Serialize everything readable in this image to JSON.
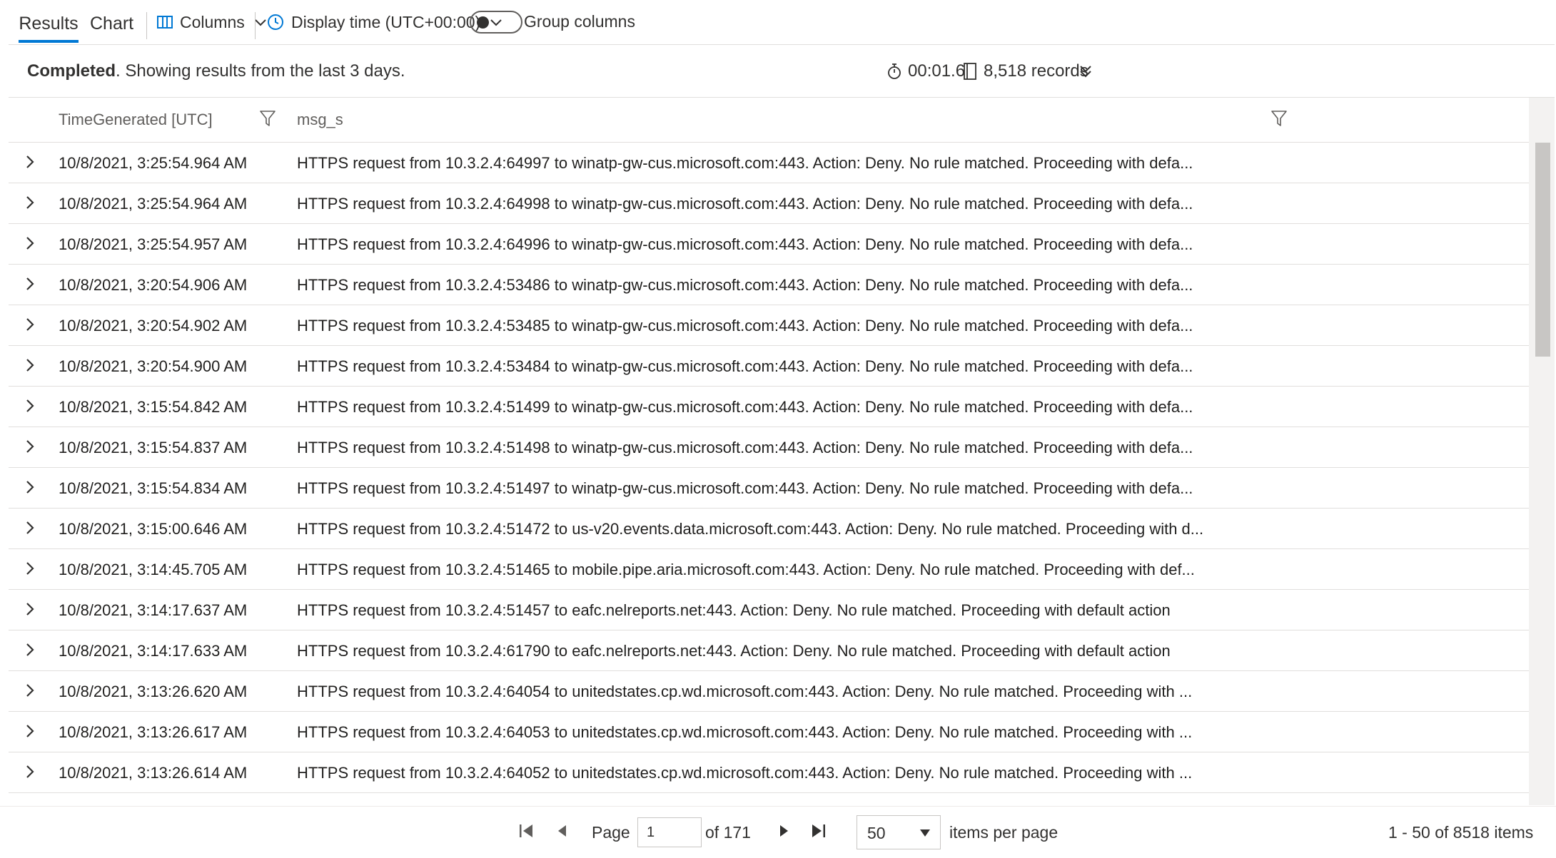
{
  "toolbar": {
    "tabs": [
      {
        "label": "Results",
        "active": true
      },
      {
        "label": "Chart",
        "active": false
      }
    ],
    "columns_label": "Columns",
    "display_time_label": "Display time (UTC+00:00)",
    "group_columns_label": "Group columns",
    "group_columns_on": false
  },
  "status": {
    "bold": "Completed",
    "text": ". Showing results from the last 3 days.",
    "duration": "00:01.6",
    "records": "8,518 records"
  },
  "grid": {
    "columns": [
      "TimeGenerated [UTC]",
      "msg_s"
    ],
    "rows": [
      {
        "time": "10/8/2021, 3:25:54.964 AM",
        "msg": "HTTPS request from 10.3.2.4:64997 to winatp-gw-cus.microsoft.com:443. Action: Deny. No rule matched. Proceeding with defa..."
      },
      {
        "time": "10/8/2021, 3:25:54.964 AM",
        "msg": "HTTPS request from 10.3.2.4:64998 to winatp-gw-cus.microsoft.com:443. Action: Deny. No rule matched. Proceeding with defa..."
      },
      {
        "time": "10/8/2021, 3:25:54.957 AM",
        "msg": "HTTPS request from 10.3.2.4:64996 to winatp-gw-cus.microsoft.com:443. Action: Deny. No rule matched. Proceeding with defa..."
      },
      {
        "time": "10/8/2021, 3:20:54.906 AM",
        "msg": "HTTPS request from 10.3.2.4:53486 to winatp-gw-cus.microsoft.com:443. Action: Deny. No rule matched. Proceeding with defa..."
      },
      {
        "time": "10/8/2021, 3:20:54.902 AM",
        "msg": "HTTPS request from 10.3.2.4:53485 to winatp-gw-cus.microsoft.com:443. Action: Deny. No rule matched. Proceeding with defa..."
      },
      {
        "time": "10/8/2021, 3:20:54.900 AM",
        "msg": "HTTPS request from 10.3.2.4:53484 to winatp-gw-cus.microsoft.com:443. Action: Deny. No rule matched. Proceeding with defa..."
      },
      {
        "time": "10/8/2021, 3:15:54.842 AM",
        "msg": "HTTPS request from 10.3.2.4:51499 to winatp-gw-cus.microsoft.com:443. Action: Deny. No rule matched. Proceeding with defa..."
      },
      {
        "time": "10/8/2021, 3:15:54.837 AM",
        "msg": "HTTPS request from 10.3.2.4:51498 to winatp-gw-cus.microsoft.com:443. Action: Deny. No rule matched. Proceeding with defa..."
      },
      {
        "time": "10/8/2021, 3:15:54.834 AM",
        "msg": "HTTPS request from 10.3.2.4:51497 to winatp-gw-cus.microsoft.com:443. Action: Deny. No rule matched. Proceeding with defa..."
      },
      {
        "time": "10/8/2021, 3:15:00.646 AM",
        "msg": "HTTPS request from 10.3.2.4:51472 to us-v20.events.data.microsoft.com:443. Action: Deny. No rule matched. Proceeding with d..."
      },
      {
        "time": "10/8/2021, 3:14:45.705 AM",
        "msg": "HTTPS request from 10.3.2.4:51465 to mobile.pipe.aria.microsoft.com:443. Action: Deny. No rule matched. Proceeding with def..."
      },
      {
        "time": "10/8/2021, 3:14:17.637 AM",
        "msg": "HTTPS request from 10.3.2.4:51457 to eafc.nelreports.net:443. Action: Deny. No rule matched. Proceeding with default action"
      },
      {
        "time": "10/8/2021, 3:14:17.633 AM",
        "msg": "HTTPS request from 10.3.2.4:61790 to eafc.nelreports.net:443. Action: Deny. No rule matched. Proceeding with default action"
      },
      {
        "time": "10/8/2021, 3:13:26.620 AM",
        "msg": "HTTPS request from 10.3.2.4:64054 to unitedstates.cp.wd.microsoft.com:443. Action: Deny. No rule matched. Proceeding with ..."
      },
      {
        "time": "10/8/2021, 3:13:26.617 AM",
        "msg": "HTTPS request from 10.3.2.4:64053 to unitedstates.cp.wd.microsoft.com:443. Action: Deny. No rule matched. Proceeding with ..."
      },
      {
        "time": "10/8/2021, 3:13:26.614 AM",
        "msg": "HTTPS request from 10.3.2.4:64052 to unitedstates.cp.wd.microsoft.com:443. Action: Deny. No rule matched. Proceeding with ..."
      }
    ]
  },
  "pager": {
    "page_label": "Page",
    "page_value": "1",
    "of_label": "of 171",
    "page_size": "50",
    "items_per_page_label": "items per page",
    "range_label": "1 - 50 of 8518 items"
  },
  "icons": {
    "columns": "columns-icon",
    "clock": "clock-icon",
    "chevron_down": "chevron-down-icon",
    "stopwatch": "stopwatch-icon",
    "records": "records-icon",
    "collapse": "double-chevron-down-icon",
    "filter": "filter-icon",
    "expand": "chevron-right-icon"
  },
  "colors": {
    "accent": "#0078d4",
    "text": "#323130",
    "border": "#e1dfdd"
  }
}
